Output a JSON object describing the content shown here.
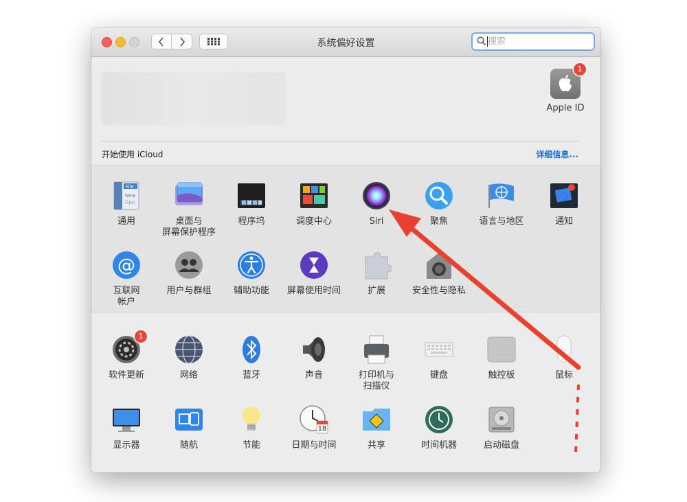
{
  "window": {
    "title": "系统偏好设置"
  },
  "search": {
    "placeholder": "搜索",
    "value": ""
  },
  "account": {
    "appleid_label": "Apple ID",
    "appleid_badge": "1",
    "icloud_text": "开始使用 iCloud",
    "details_link": "详细信息..."
  },
  "row1": [
    {
      "label": "通用",
      "icon": "general-icon"
    },
    {
      "label": "桌面与\n屏幕保护程序",
      "icon": "desktop-screensaver-icon"
    },
    {
      "label": "程序坞",
      "icon": "dock-icon"
    },
    {
      "label": "调度中心",
      "icon": "mission-control-icon"
    },
    {
      "label": "Siri",
      "icon": "siri-icon"
    },
    {
      "label": "聚焦",
      "icon": "spotlight-icon"
    },
    {
      "label": "语言与地区",
      "icon": "language-region-icon"
    },
    {
      "label": "通知",
      "icon": "notifications-icon"
    }
  ],
  "row2": [
    {
      "label": "互联网\n帐户",
      "icon": "internet-accounts-icon"
    },
    {
      "label": "用户与群组",
      "icon": "users-groups-icon"
    },
    {
      "label": "辅助功能",
      "icon": "accessibility-icon"
    },
    {
      "label": "屏幕使用时间",
      "icon": "screen-time-icon"
    },
    {
      "label": "扩展",
      "icon": "extensions-icon"
    },
    {
      "label": "安全性与隐私",
      "icon": "security-privacy-icon"
    }
  ],
  "row3": [
    {
      "label": "软件更新",
      "icon": "software-update-icon",
      "badge": "1"
    },
    {
      "label": "网络",
      "icon": "network-icon"
    },
    {
      "label": "蓝牙",
      "icon": "bluetooth-icon"
    },
    {
      "label": "声音",
      "icon": "sound-icon"
    },
    {
      "label": "打印机与\n扫描仪",
      "icon": "printers-scanners-icon"
    },
    {
      "label": "键盘",
      "icon": "keyboard-icon"
    },
    {
      "label": "触控板",
      "icon": "trackpad-icon"
    },
    {
      "label": "鼠标",
      "icon": "mouse-icon"
    }
  ],
  "row4": [
    {
      "label": "显示器",
      "icon": "displays-icon"
    },
    {
      "label": "随航",
      "icon": "sidecar-icon"
    },
    {
      "label": "节能",
      "icon": "energy-saver-icon"
    },
    {
      "label": "日期与时间",
      "icon": "date-time-icon",
      "date": "18"
    },
    {
      "label": "共享",
      "icon": "sharing-icon"
    },
    {
      "label": "时间机器",
      "icon": "time-machine-icon"
    },
    {
      "label": "启动磁盘",
      "icon": "startup-disk-icon"
    }
  ],
  "colors": {
    "accent": "#1a6bd6",
    "annotation_arrow": "#e8412f",
    "badge": "#e8453c"
  }
}
